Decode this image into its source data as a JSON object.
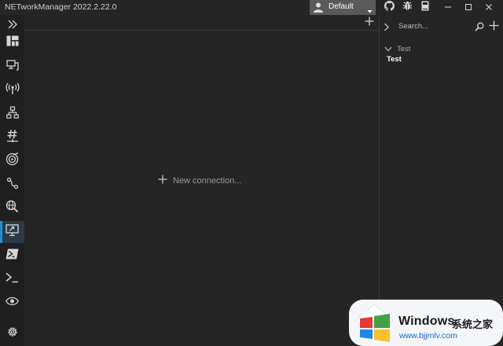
{
  "app": {
    "title": "NETworkManager 2022.2.22.0"
  },
  "profile_selector": {
    "value": "Default"
  },
  "titlebar_icons": [
    "github-icon",
    "bug-icon",
    "book-icon",
    "minimize-icon",
    "maximize-icon",
    "close-icon"
  ],
  "sidebar": {
    "items": [
      {
        "id": "expand",
        "icon": "chevrons-right-icon"
      },
      {
        "id": "dashboard",
        "icon": "dashboard-icon"
      },
      {
        "id": "network-interface",
        "icon": "network-interface-icon"
      },
      {
        "id": "wifi",
        "icon": "wifi-icon"
      },
      {
        "id": "ip-scanner",
        "icon": "network-tree-icon"
      },
      {
        "id": "port-scanner",
        "icon": "hash-icon"
      },
      {
        "id": "ping",
        "icon": "ping-icon"
      },
      {
        "id": "traceroute",
        "icon": "traceroute-icon"
      },
      {
        "id": "dns-lookup",
        "icon": "globe-search-icon"
      },
      {
        "id": "remote-desktop",
        "icon": "remote-desktop-icon",
        "active": true
      },
      {
        "id": "powershell",
        "icon": "powershell-icon"
      },
      {
        "id": "putty",
        "icon": "terminal-icon"
      },
      {
        "id": "tigervnc",
        "icon": "eye-icon"
      },
      {
        "id": "settings",
        "icon": "gear-icon"
      }
    ]
  },
  "main": {
    "new_connection_label": "New connection..."
  },
  "profiles_panel": {
    "search_placeholder": "Search...",
    "groups": [
      {
        "name": "Test",
        "expanded": true,
        "profiles": [
          "Test"
        ]
      }
    ]
  },
  "watermark": {
    "brand": "Windows",
    "cn_text": "系统之家",
    "url": "www.bjjmlv.com"
  },
  "colors": {
    "background": "#252525",
    "sidebar": "#1f1f1f",
    "accent": "#1e8fd6",
    "profile_selector": "#5a5a5a"
  }
}
